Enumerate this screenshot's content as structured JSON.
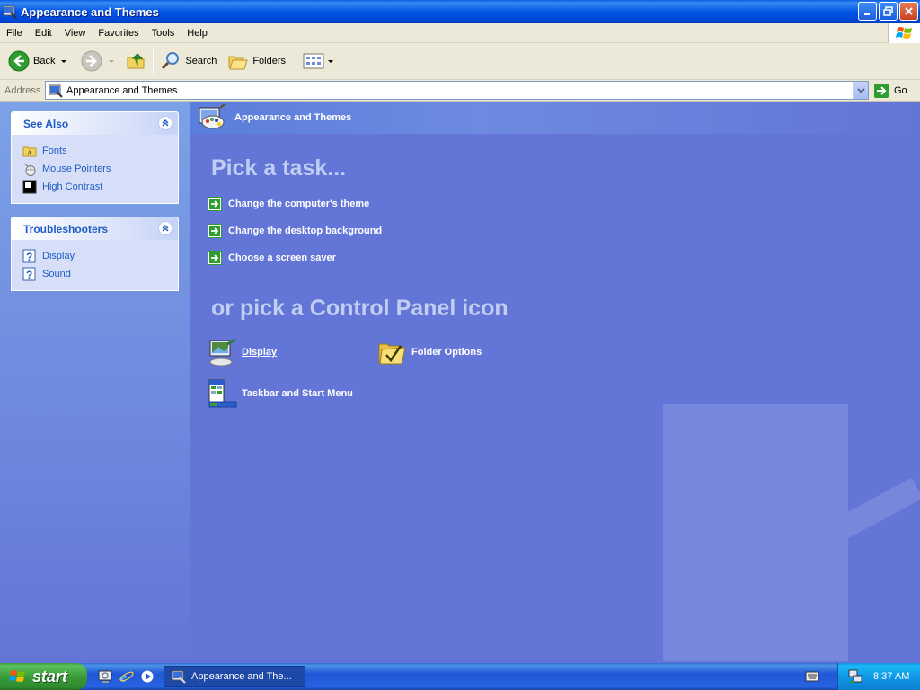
{
  "window": {
    "title": "Appearance and Themes",
    "icons": {
      "app": "control-panel-icon",
      "minimize": "minimize-icon",
      "maximize": "restore-icon",
      "close": "close-icon"
    }
  },
  "menubar": {
    "items": [
      "File",
      "Edit",
      "View",
      "Favorites",
      "Tools",
      "Help"
    ],
    "logo": "windows-flag-icon"
  },
  "toolbar": {
    "back_label": "Back",
    "search_label": "Search",
    "folders_label": "Folders",
    "icons": [
      "back-arrow-icon",
      "forward-arrow-icon",
      "up-folder-icon",
      "search-icon",
      "folders-icon",
      "views-icon"
    ]
  },
  "address": {
    "label": "Address",
    "value": "Appearance and Themes",
    "go_label": "Go"
  },
  "sidebar": {
    "see_also": {
      "title": "See Also",
      "items": [
        {
          "label": "Fonts",
          "icon": "fonts-folder-icon"
        },
        {
          "label": "Mouse Pointers",
          "icon": "mouse-icon"
        },
        {
          "label": "High Contrast",
          "icon": "high-contrast-icon"
        }
      ]
    },
    "troubleshooters": {
      "title": "Troubleshooters",
      "items": [
        {
          "label": "Display",
          "icon": "help-icon"
        },
        {
          "label": "Sound",
          "icon": "help-icon"
        }
      ]
    }
  },
  "main": {
    "header_title": "Appearance and Themes",
    "pick_task_heading": "Pick a task...",
    "tasks": [
      "Change the computer's theme",
      "Change the desktop background",
      "Choose a screen saver"
    ],
    "or_pick_heading": "or pick a Control Panel icon",
    "icons": [
      {
        "label": "Display",
        "icon": "display-icon"
      },
      {
        "label": "Folder Options",
        "icon": "folder-options-icon"
      },
      {
        "label": "Taskbar and Start Menu",
        "icon": "taskbar-icon"
      }
    ]
  },
  "taskbar": {
    "start_label": "start",
    "quick_launch": [
      "show-desktop-icon",
      "internet-explorer-icon",
      "media-player-icon"
    ],
    "active_task": "Appearance and The...",
    "clock": "8:37 AM",
    "tray_icons": [
      "keyboard-icon",
      "network-icon"
    ]
  },
  "colors": {
    "titlebar": "#0055e5",
    "main_background": "#6375d6",
    "sidebar_link": "#215dc6",
    "start_button": "#3a9b3a",
    "tray": "#0f97e8"
  }
}
